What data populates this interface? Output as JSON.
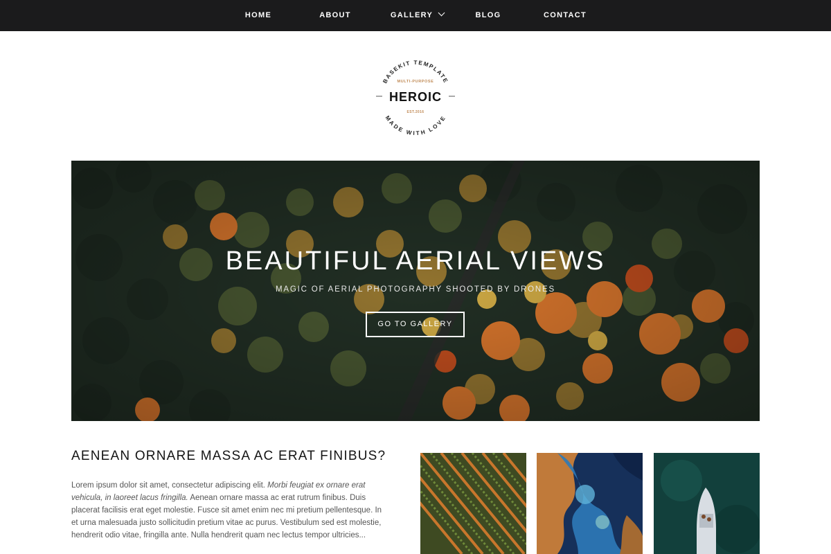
{
  "nav": {
    "items": [
      {
        "label": "HOME"
      },
      {
        "label": "ABOUT"
      },
      {
        "label": "GALLERY"
      },
      {
        "label": "BLOG"
      },
      {
        "label": "CONTACT"
      }
    ],
    "gallery_dropdown_icon": "chevron-down-icon"
  },
  "logo": {
    "top_arc": "BASEKIT TEMPLATE",
    "tagline": "MULTI-PURPOSE",
    "name": "HEROIC",
    "established": "EST.2016",
    "bottom_arc": "MADE WITH LOVE",
    "accent_color": "#c08a55"
  },
  "hero": {
    "title": "BEAUTIFUL AERIAL VIEWS",
    "subtitle": "MAGIC OF AERIAL PHOTOGRAPHY SHOOTED BY DRONES",
    "button_label": "GO TO GALLERY"
  },
  "article": {
    "title": "AENEAN ORNARE MASSA AC ERAT FINIBUS?",
    "body_part1": "Lorem ipsum dolor sit amet, consectetur adipiscing elit. ",
    "body_italic": "Morbi feugiat ex ornare erat vehicula, in laoreet lacus fringilla.",
    "body_part2": " Aenean ornare massa ac erat rutrum finibus. Duis placerat facilisis erat eget molestie. Fusce sit amet enim nec mi pretium pellentesque. In et urna malesuada justo sollicitudin pretium vitae ac purus. Vestibulum sed est molestie, hendrerit odio vitae, fringilla ante. Nulla hendrerit quam nec lectus tempor ultricies..."
  },
  "colors": {
    "nav_bg": "#1b1b1c",
    "foliage_orange": "#e07a2e",
    "foliage_dark": "#2c3a2a"
  }
}
